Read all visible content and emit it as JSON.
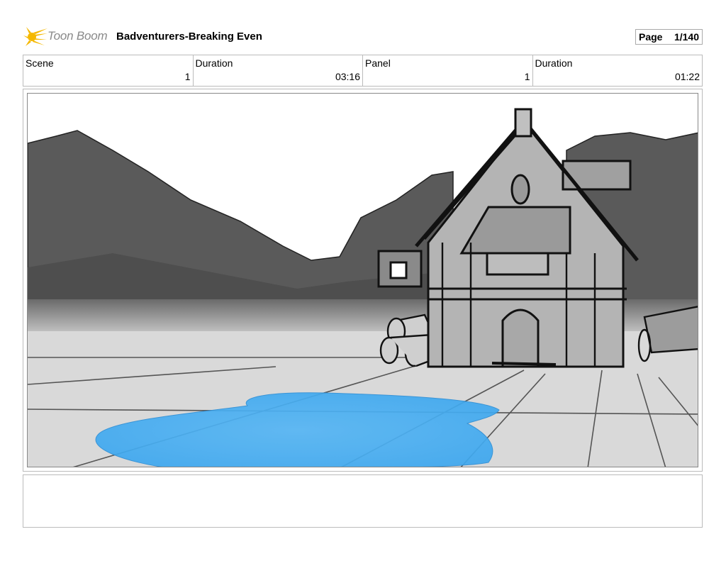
{
  "header": {
    "brand": "Toon Boom",
    "logo_icon": "sun-flare-icon",
    "title": "Badventurers-Breaking Even",
    "page_label": "Page",
    "page_value": "1/140"
  },
  "info": {
    "scene_label": "Scene",
    "scene_value": "1",
    "scene_duration_label": "Duration",
    "scene_duration_value": "03:16",
    "panel_label": "Panel",
    "panel_value": "1",
    "panel_duration_label": "Duration",
    "panel_duration_value": "01:22"
  },
  "notes": {
    "text": ""
  },
  "colors": {
    "logo_yellow": "#f5b800",
    "brand_gray": "#8a8a8a",
    "water_blue": "#3eaaf0",
    "sky": "#ffffff",
    "mountains": "#555555",
    "ground": "#d8d8d8"
  }
}
